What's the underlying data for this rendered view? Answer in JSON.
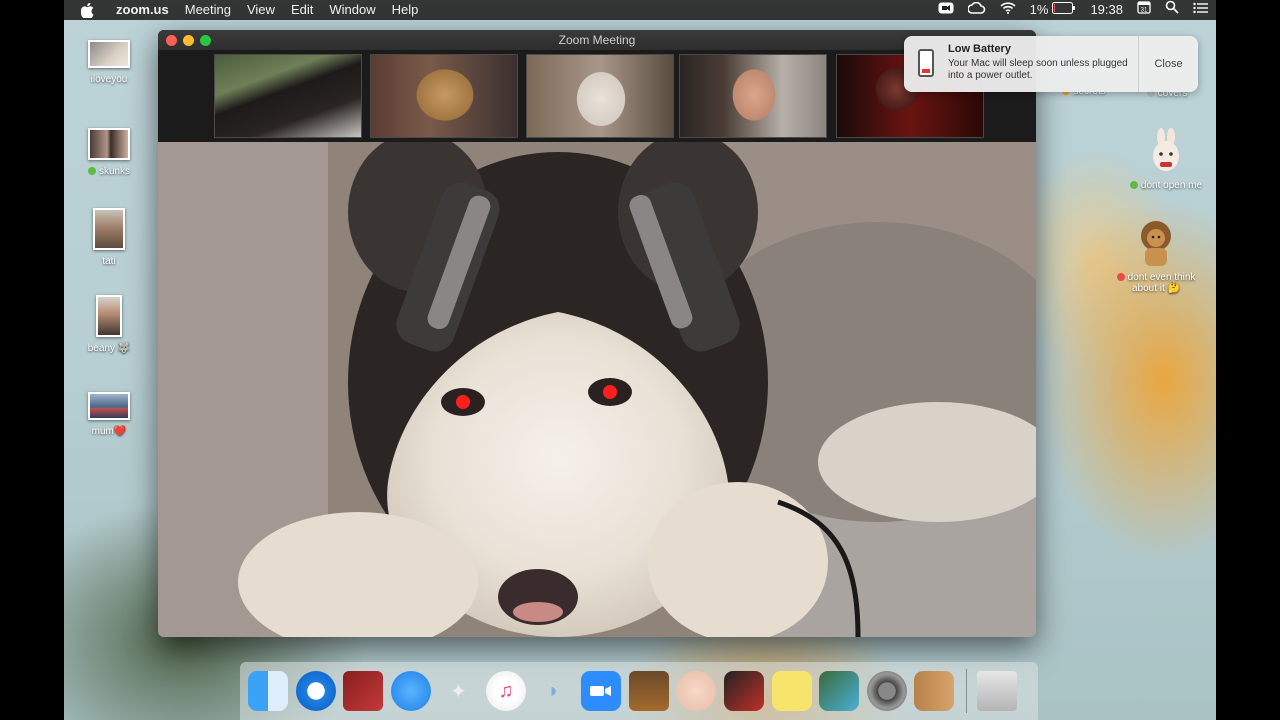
{
  "menubar": {
    "app_name": "zoom.us",
    "menus": [
      "Meeting",
      "View",
      "Edit",
      "Window",
      "Help"
    ],
    "battery": "1%",
    "clock": "19:38",
    "icons": [
      "apple-icon",
      "zoom-status-icon",
      "creative-cloud-icon",
      "wifi-icon",
      "battery-icon",
      "calendar-icon",
      "search-icon",
      "control-center-icon"
    ]
  },
  "desktop": {
    "left_icons": [
      {
        "label": "iloveyou",
        "dot": ""
      },
      {
        "label": "skunks",
        "dot": "#5dbb3f"
      },
      {
        "label": "tati",
        "dot": ""
      },
      {
        "label": "beany 🐺",
        "dot": ""
      },
      {
        "label": "mum❤️",
        "dot": ""
      }
    ],
    "right_icons": [
      {
        "label": "secrets"
      },
      {
        "label": "covers"
      },
      {
        "label": "dont open me",
        "dot": "#5dbb3f"
      },
      {
        "label": "dont even think about it 🤔",
        "dot": "#e94b4b"
      }
    ]
  },
  "zoom": {
    "window_title": "Zoom Meeting",
    "participant_count": 5
  },
  "notification": {
    "title": "Low Battery",
    "body": "Your Mac will sleep soon unless plugged into a power outlet.",
    "close_label": "Close"
  },
  "dock": {
    "apps": [
      "finder-icon",
      "safari-icon",
      "photo-booth-icon",
      "messages-icon",
      "unknown-app-icon",
      "itunes-icon",
      "sequel-pro-icon",
      "zoom-icon",
      "garageband-icon",
      "face-app-icon",
      "photo-app-icon",
      "stickies-icon",
      "preview-icon",
      "system-preferences-icon",
      "contacts-icon"
    ],
    "trash": "trash-icon"
  }
}
